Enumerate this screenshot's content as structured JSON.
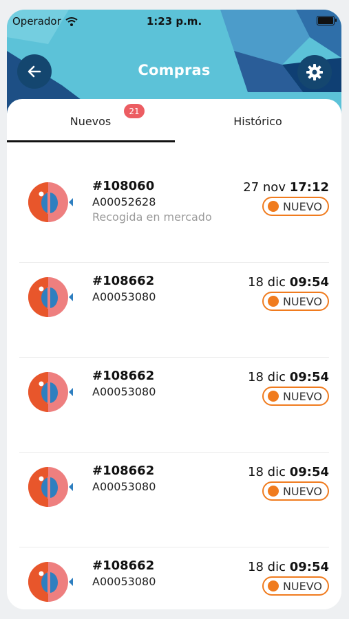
{
  "status_bar": {
    "carrier": "Operador",
    "time": "1:23 p.m."
  },
  "header": {
    "title": "Compras"
  },
  "tabs": [
    {
      "label": "Nuevos",
      "badge": "21",
      "active": true
    },
    {
      "label": "Histórico",
      "active": false
    }
  ],
  "orders": [
    {
      "number": "#108060",
      "code": "A00052628",
      "note": "Recogida en mercado",
      "date": "27 nov",
      "time": "17:12",
      "status": "NUEVO"
    },
    {
      "number": "#108662",
      "code": "A00053080",
      "note": "",
      "date": "18 dic",
      "time": "09:54",
      "status": "NUEVO"
    },
    {
      "number": "#108662",
      "code": "A00053080",
      "note": "",
      "date": "18 dic",
      "time": "09:54",
      "status": "NUEVO"
    },
    {
      "number": "#108662",
      "code": "A00053080",
      "note": "",
      "date": "18 dic",
      "time": "09:54",
      "status": "NUEVO"
    },
    {
      "number": "#108662",
      "code": "A00053080",
      "note": "",
      "date": "18 dic",
      "time": "09:54",
      "status": "NUEVO"
    }
  ],
  "colors": {
    "header_bg": "#5cc2d8",
    "button_bg": "#14466f",
    "accent_orange": "#f07b1e",
    "badge_red": "#ec5d62"
  },
  "icons": {
    "back": "arrow-left-icon",
    "settings": "gear-icon",
    "wifi": "wifi-icon",
    "battery": "battery-icon",
    "avatar": "fish-logo-icon"
  }
}
